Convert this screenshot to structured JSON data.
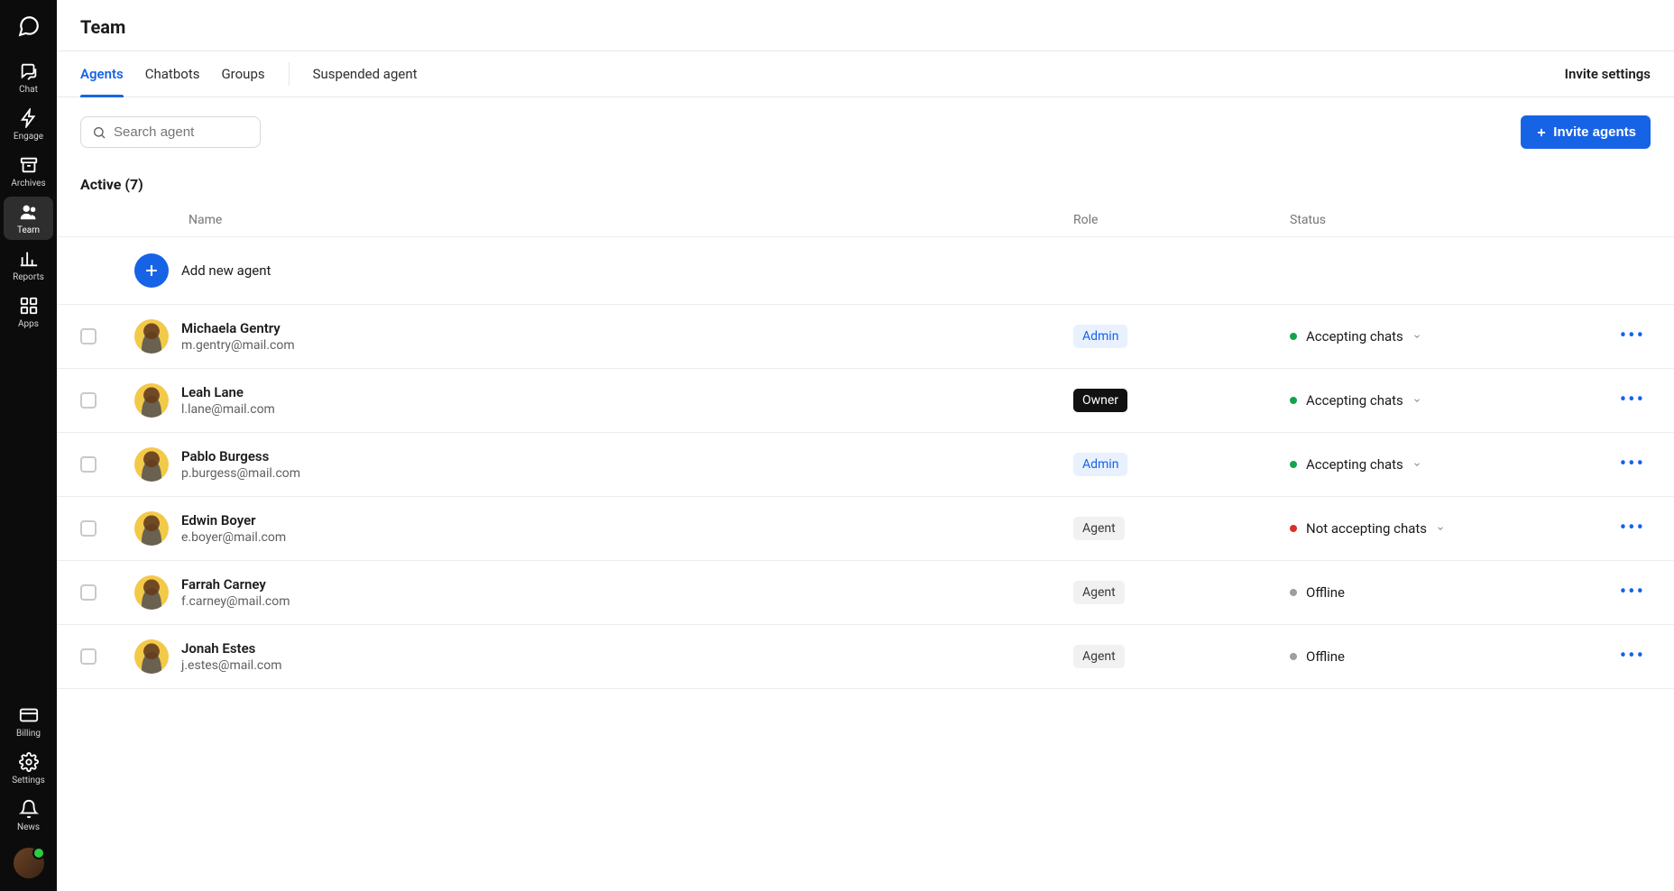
{
  "page": {
    "title": "Team"
  },
  "sidebar": {
    "items": [
      {
        "label": "Chat",
        "icon": "chat-icon"
      },
      {
        "label": "Engage",
        "icon": "bolt-icon"
      },
      {
        "label": "Archives",
        "icon": "archive-icon"
      },
      {
        "label": "Team",
        "icon": "team-icon",
        "active": true
      },
      {
        "label": "Reports",
        "icon": "reports-icon"
      },
      {
        "label": "Apps",
        "icon": "apps-icon"
      }
    ],
    "bottom": [
      {
        "label": "Billing",
        "icon": "billing-icon"
      },
      {
        "label": "Settings",
        "icon": "settings-icon"
      },
      {
        "label": "News",
        "icon": "news-icon"
      }
    ]
  },
  "tabs": {
    "items": [
      "Agents",
      "Chatbots",
      "Groups",
      "Suspended agent"
    ],
    "active_index": 0,
    "invite_settings": "Invite settings"
  },
  "search": {
    "placeholder": "Search agent"
  },
  "invite_button": "Invite agents",
  "section": {
    "heading": "Active (7)",
    "columns": {
      "name": "Name",
      "role": "Role",
      "status": "Status"
    },
    "add_new_label": "Add new agent"
  },
  "status_colors": {
    "accepting": "#13a44a",
    "not_accepting": "#d93025",
    "offline": "#9e9e9e"
  },
  "agents": [
    {
      "name": "Michaela Gentry",
      "email": "m.gentry@mail.com",
      "role": "Admin",
      "role_style": "admin",
      "status": "Accepting chats",
      "status_kind": "accepting",
      "status_dropdown": true
    },
    {
      "name": "Leah Lane",
      "email": "l.lane@mail.com",
      "role": "Owner",
      "role_style": "owner",
      "status": "Accepting chats",
      "status_kind": "accepting",
      "status_dropdown": true
    },
    {
      "name": "Pablo Burgess",
      "email": "p.burgess@mail.com",
      "role": "Admin",
      "role_style": "admin",
      "status": "Accepting chats",
      "status_kind": "accepting",
      "status_dropdown": true
    },
    {
      "name": "Edwin Boyer",
      "email": "e.boyer@mail.com",
      "role": "Agent",
      "role_style": "agent",
      "status": "Not accepting chats",
      "status_kind": "not_accepting",
      "status_dropdown": true
    },
    {
      "name": "Farrah Carney",
      "email": "f.carney@mail.com",
      "role": "Agent",
      "role_style": "agent",
      "status": "Offline",
      "status_kind": "offline",
      "status_dropdown": false
    },
    {
      "name": "Jonah Estes",
      "email": "j.estes@mail.com",
      "role": "Agent",
      "role_style": "agent",
      "status": "Offline",
      "status_kind": "offline",
      "status_dropdown": false
    }
  ]
}
